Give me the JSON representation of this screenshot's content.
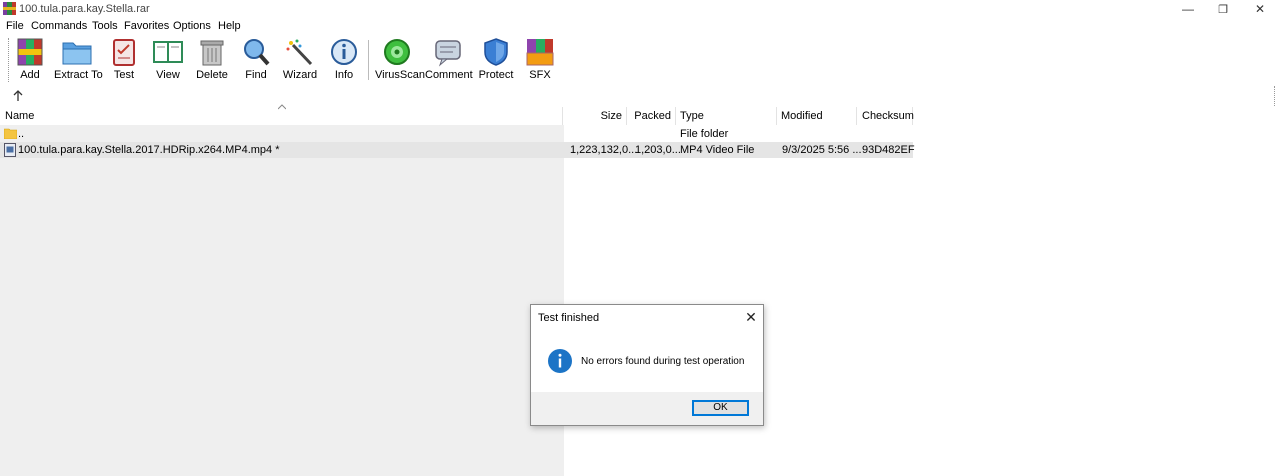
{
  "window": {
    "title": "100.tula.para.kay.Stella.rar",
    "minimize_glyph": "—",
    "maximize_glyph": "❐",
    "close_glyph": "✕"
  },
  "menu": [
    "File",
    "Commands",
    "Tools",
    "Favorites",
    "Options",
    "Help"
  ],
  "toolbar": {
    "add": "Add",
    "extract": "Extract To",
    "test": "Test",
    "view": "View",
    "delete": "Delete",
    "find": "Find",
    "wizard": "Wizard",
    "info": "Info",
    "virusscan": "VirusScan",
    "comment": "Comment",
    "protect": "Protect",
    "sfx": "SFX"
  },
  "columns": {
    "name": "Name",
    "size": "Size",
    "packed": "Packed",
    "type": "Type",
    "modified": "Modified",
    "checksum": "Checksum"
  },
  "rows": [
    {
      "icon": "folder-icon",
      "name": "..",
      "size": "",
      "packed": "",
      "type": "File folder",
      "modified": "",
      "checksum": ""
    },
    {
      "icon": "video-file-icon",
      "name": "100.tula.para.kay.Stella.2017.HDRip.x264.MP4.mp4 *",
      "size": "1,223,132,0...",
      "packed": "1,203,0...",
      "type": "MP4 Video File",
      "modified": "9/3/2025 5:56 ...",
      "checksum": "93D482EF"
    }
  ],
  "dialog": {
    "title": "Test finished",
    "message": "No errors found during test operation",
    "ok_label": "OK",
    "close_glyph": "✕"
  },
  "colors": {
    "accent": "#0078d7",
    "info_icon": "#1c74c6",
    "folder": "#f4c542",
    "selected_row": "#e5e5e5"
  }
}
